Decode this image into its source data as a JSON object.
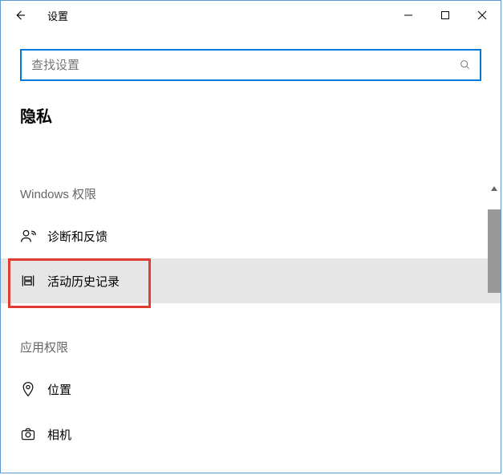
{
  "window": {
    "title": "设置"
  },
  "search": {
    "placeholder": "查找设置"
  },
  "page": {
    "heading": "隐私"
  },
  "sections": {
    "windows_permissions": {
      "label": "Windows 权限"
    },
    "app_permissions": {
      "label": "应用权限"
    }
  },
  "items": {
    "diagnostics": {
      "label": "诊断和反馈"
    },
    "activity_history": {
      "label": "活动历史记录"
    },
    "location": {
      "label": "位置"
    },
    "camera": {
      "label": "相机"
    }
  }
}
